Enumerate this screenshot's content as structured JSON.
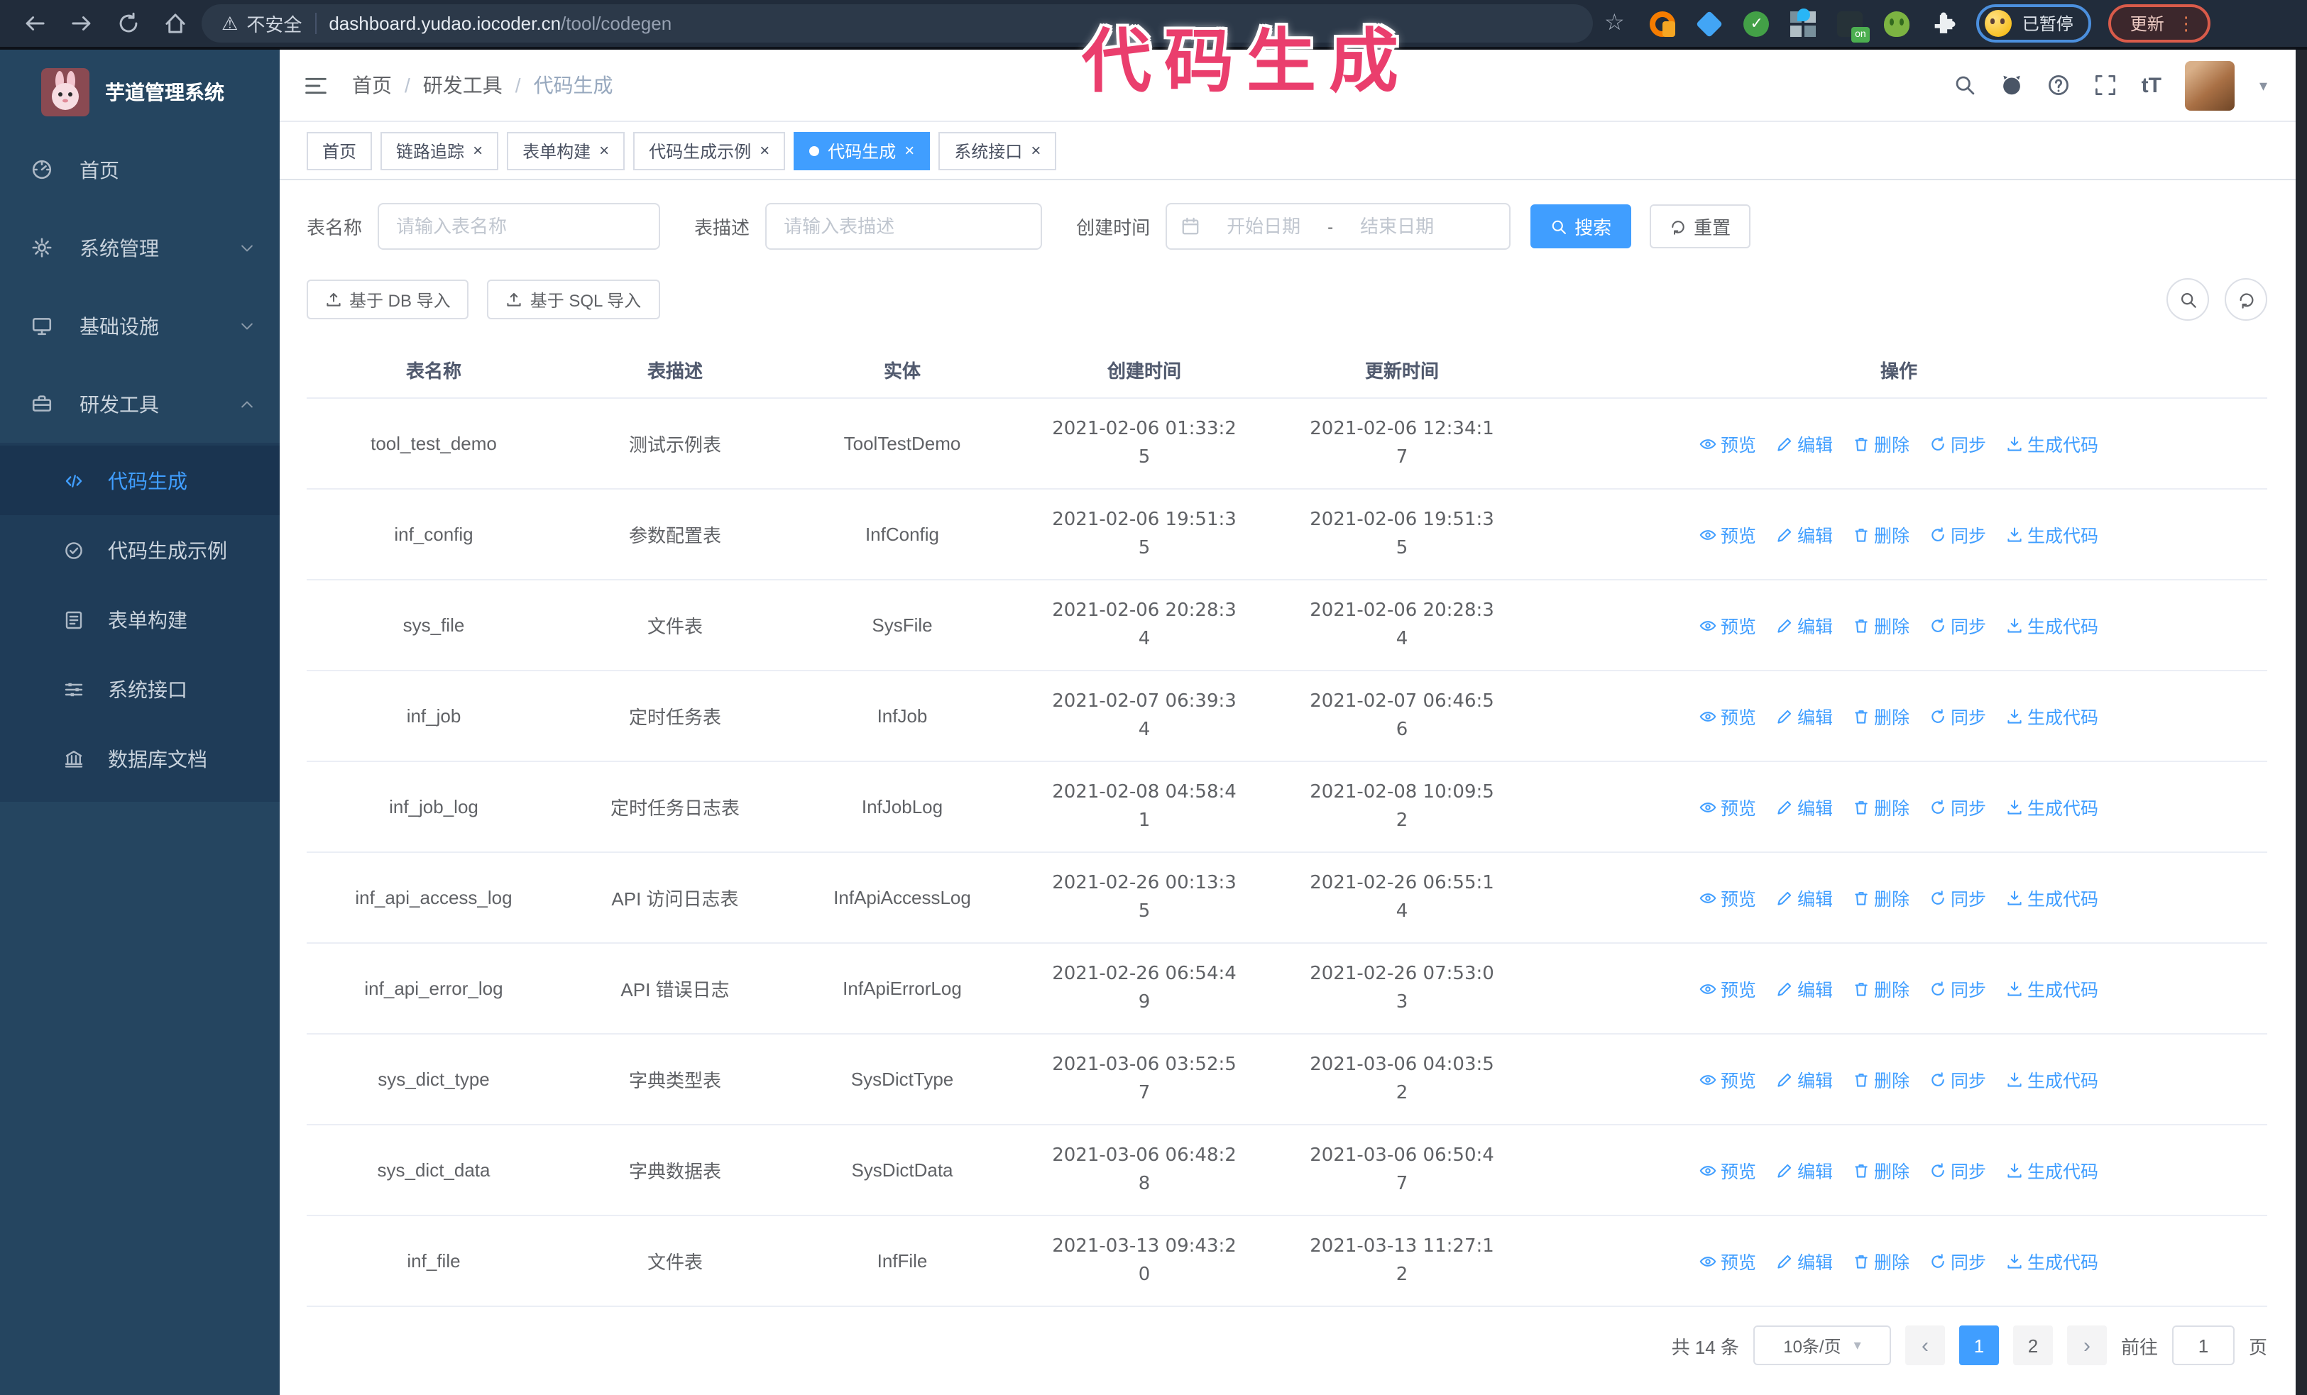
{
  "browser": {
    "security_warning": "不安全",
    "url_host": "dashboard.yudao.iocoder.cn",
    "url_path": "/tool/codegen",
    "extension_badge": "on",
    "paused_badge": "已暂停",
    "update_button": "更新"
  },
  "glyphs": {
    "warning": "⚠",
    "star": "☆",
    "kebab": "⋮",
    "breadcrumb_separator": "/",
    "close": "×",
    "caret": "▾",
    "prev": "‹",
    "next": "›",
    "font_size_icon": "tT",
    "date_separator": "-"
  },
  "annotation": {
    "text": "代码生成"
  },
  "sidebar": {
    "title": "芋道管理系统",
    "menu": [
      {
        "key": "home",
        "label": "首页",
        "icon": "dashboard",
        "expandable": false
      },
      {
        "key": "system",
        "label": "系统管理",
        "icon": "gear",
        "expandable": true,
        "state": "collapsed"
      },
      {
        "key": "infra",
        "label": "基础设施",
        "icon": "monitor",
        "expandable": true,
        "state": "collapsed"
      },
      {
        "key": "dev-tools",
        "label": "研发工具",
        "icon": "toolbox",
        "expandable": true,
        "state": "expanded"
      }
    ],
    "submenu": [
      {
        "key": "codegen",
        "label": "代码生成",
        "icon": "code",
        "active": true
      },
      {
        "key": "codegen-demo",
        "label": "代码生成示例",
        "icon": "badgecheck",
        "active": false
      },
      {
        "key": "form-builder",
        "label": "表单构建",
        "icon": "form",
        "active": false
      },
      {
        "key": "system-api",
        "label": "系统接口",
        "icon": "sliders",
        "active": false
      },
      {
        "key": "db-doc",
        "label": "数据库文档",
        "icon": "dbdoc",
        "active": false
      }
    ]
  },
  "breadcrumb": {
    "items": [
      "首页",
      "研发工具",
      "代码生成"
    ]
  },
  "tabs": [
    {
      "key": "home",
      "label": "首页",
      "closable": false,
      "active": false
    },
    {
      "key": "tracing",
      "label": "链路追踪",
      "closable": true,
      "active": false
    },
    {
      "key": "form-builder",
      "label": "表单构建",
      "closable": true,
      "active": false
    },
    {
      "key": "codegen-demo",
      "label": "代码生成示例",
      "closable": true,
      "active": false
    },
    {
      "key": "codegen",
      "label": "代码生成",
      "closable": true,
      "active": true
    },
    {
      "key": "system-api",
      "label": "系统接口",
      "closable": true,
      "active": false
    }
  ],
  "search_form": {
    "table_name_label": "表名称",
    "table_name_placeholder": "请输入表名称",
    "table_desc_label": "表描述",
    "table_desc_placeholder": "请输入表描述",
    "create_time_label": "创建时间",
    "date_start_placeholder": "开始日期",
    "date_end_placeholder": "结束日期",
    "search_button": "搜索",
    "reset_button": "重置"
  },
  "toolbar": {
    "import_db_button": "基于 DB 导入",
    "import_sql_button": "基于 SQL 导入"
  },
  "table": {
    "columns": [
      "表名称",
      "表描述",
      "实体",
      "创建时间",
      "更新时间",
      "操作"
    ],
    "actions": [
      "预览",
      "编辑",
      "删除",
      "同步",
      "生成代码"
    ],
    "rows": [
      {
        "name": "tool_test_demo",
        "desc": "测试示例表",
        "entity": "ToolTestDemo",
        "create_time": "2021-02-06 01:33:25",
        "update_time": "2021-02-06 12:34:17"
      },
      {
        "name": "inf_config",
        "desc": "参数配置表",
        "entity": "InfConfig",
        "create_time": "2021-02-06 19:51:35",
        "update_time": "2021-02-06 19:51:35"
      },
      {
        "name": "sys_file",
        "desc": "文件表",
        "entity": "SysFile",
        "create_time": "2021-02-06 20:28:34",
        "update_time": "2021-02-06 20:28:34"
      },
      {
        "name": "inf_job",
        "desc": "定时任务表",
        "entity": "InfJob",
        "create_time": "2021-02-07 06:39:34",
        "update_time": "2021-02-07 06:46:56"
      },
      {
        "name": "inf_job_log",
        "desc": "定时任务日志表",
        "entity": "InfJobLog",
        "create_time": "2021-02-08 04:58:41",
        "update_time": "2021-02-08 10:09:52"
      },
      {
        "name": "inf_api_access_log",
        "desc": "API 访问日志表",
        "entity": "InfApiAccessLog",
        "create_time": "2021-02-26 00:13:35",
        "update_time": "2021-02-26 06:55:14"
      },
      {
        "name": "inf_api_error_log",
        "desc": "API 错误日志",
        "entity": "InfApiErrorLog",
        "create_time": "2021-02-26 06:54:49",
        "update_time": "2021-02-26 07:53:03"
      },
      {
        "name": "sys_dict_type",
        "desc": "字典类型表",
        "entity": "SysDictType",
        "create_time": "2021-03-06 03:52:57",
        "update_time": "2021-03-06 04:03:52"
      },
      {
        "name": "sys_dict_data",
        "desc": "字典数据表",
        "entity": "SysDictData",
        "create_time": "2021-03-06 06:48:28",
        "update_time": "2021-03-06 06:50:47"
      },
      {
        "name": "inf_file",
        "desc": "文件表",
        "entity": "InfFile",
        "create_time": "2021-03-13 09:43:20",
        "update_time": "2021-03-13 11:27:12"
      }
    ]
  },
  "pagination": {
    "total_text": "共 14 条",
    "page_size": "10条/页",
    "pages": [
      "1",
      "2"
    ],
    "active_page": "1",
    "goto_label": "前往",
    "goto_value": "1",
    "goto_suffix": "页"
  },
  "colors": {
    "accent": "#409eff",
    "sidebar_bg": "#254560",
    "annotation_pink": "#ea3e6d",
    "browser_bar": "#212c3b"
  }
}
